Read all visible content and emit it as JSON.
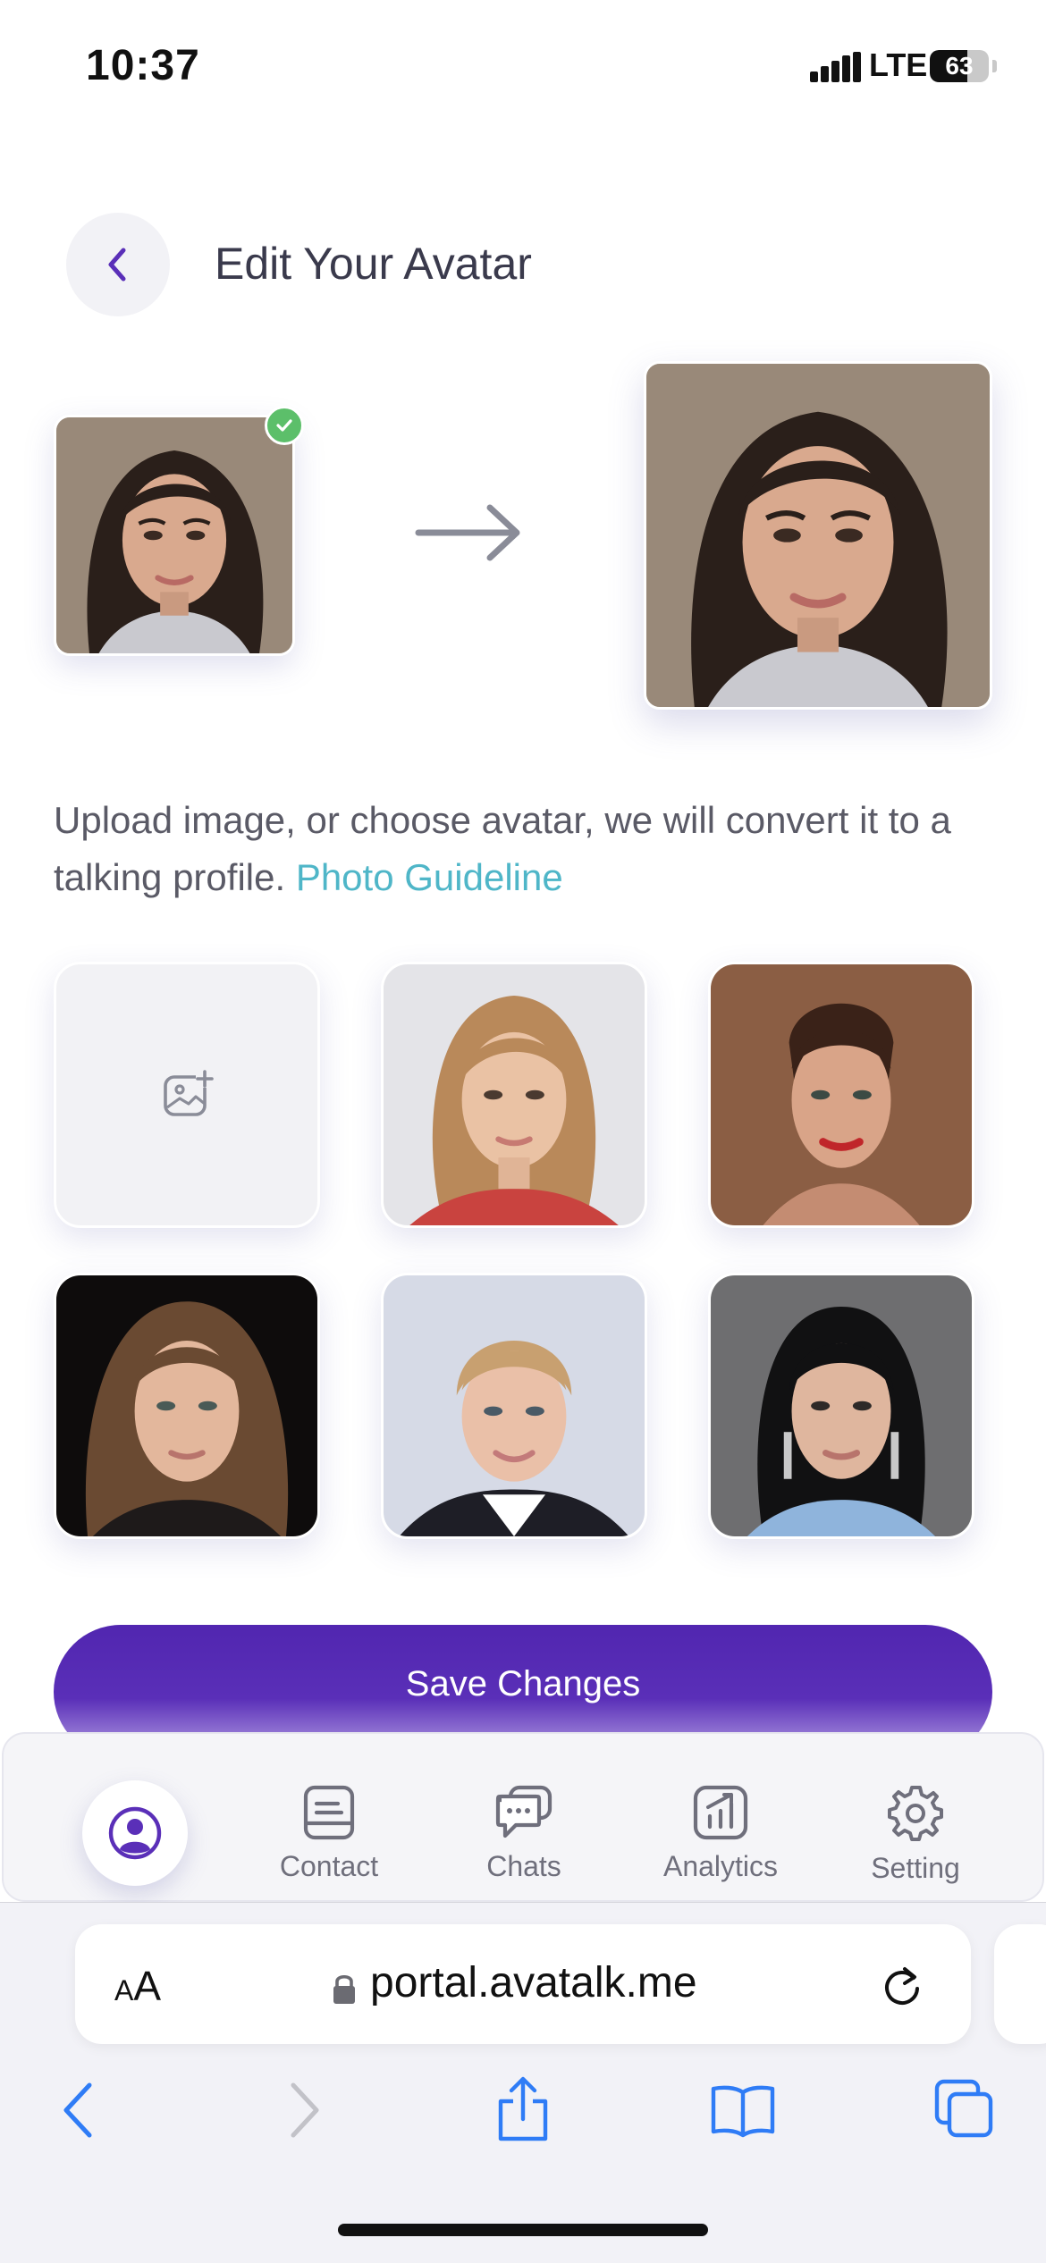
{
  "status_bar": {
    "time": "10:37",
    "network": "LTE",
    "battery": "63",
    "battery_level": 0.63
  },
  "header": {
    "title": "Edit Your Avatar"
  },
  "description": {
    "text": "Upload image, or choose avatar, we will convert it to a talking profile. ",
    "link": "Photo Guideline"
  },
  "grid": {
    "upload_icon": "image-add-icon",
    "avatars": [
      "avatar-option-1",
      "avatar-option-2",
      "avatar-option-3",
      "avatar-option-4",
      "avatar-option-5"
    ]
  },
  "save_button": {
    "label": "Save Changes"
  },
  "bottom_nav": {
    "items": [
      {
        "label": "",
        "icon": "profile-icon"
      },
      {
        "label": "Contact",
        "icon": "contact-icon"
      },
      {
        "label": "Chats",
        "icon": "chats-icon"
      },
      {
        "label": "Analytics",
        "icon": "analytics-icon"
      },
      {
        "label": "Setting",
        "icon": "gear-icon"
      }
    ]
  },
  "browser": {
    "text_size_label": "AA",
    "url": "portal.avatalk.me"
  },
  "colors": {
    "accent": "#5a2fb8",
    "link": "#4fb6c8",
    "success": "#5cbf6a",
    "browser_blue": "#2f7cf6"
  }
}
